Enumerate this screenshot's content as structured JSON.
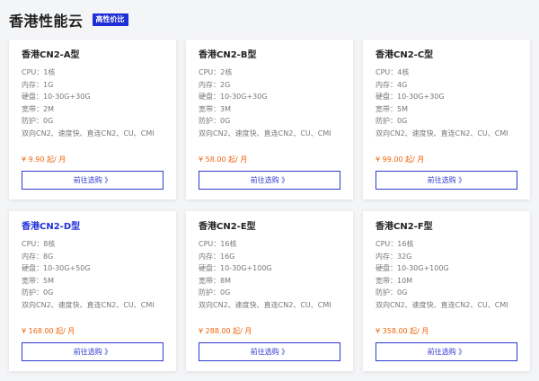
{
  "header": {
    "title": "香港性能云",
    "badge": "高性价比"
  },
  "labels": {
    "cpu": "CPU：",
    "mem": "内存：",
    "disk": "硬盘：",
    "bw": "宽带：",
    "ddos": "防护："
  },
  "cards": [
    {
      "name": "香港CN2-A型",
      "cpu": "1核",
      "mem": "1G",
      "disk": "10-30G+30G",
      "bw": "2M",
      "ddos": "0G",
      "features": "双向CN2、速度快、直连CN2、CU、CMI",
      "price": "¥ 9.90 起/ 月",
      "button": "前往选购 》"
    },
    {
      "name": "香港CN2-B型",
      "cpu": "2核",
      "mem": "2G",
      "disk": "10-30G+30G",
      "bw": "3M",
      "ddos": "0G",
      "features": "双向CN2、速度快、直连CN2、CU、CMI",
      "price": "¥ 58.00 起/ 月",
      "button": "前往选购 》"
    },
    {
      "name": "香港CN2-C型",
      "cpu": "4核",
      "mem": "4G",
      "disk": "10-30G+30G",
      "bw": "5M",
      "ddos": "0G",
      "features": "双向CN2、速度快、直连CN2、CU、CMI",
      "price": "¥ 99.00 起/ 月",
      "button": "前往选购 》"
    },
    {
      "name": "香港CN2-D型",
      "cpu": "8核",
      "mem": "8G",
      "disk": "10-30G+50G",
      "bw": "5M",
      "ddos": "0G",
      "features": "双向CN2、速度快、直连CN2、CU、CMI",
      "price": "¥ 168.00 起/ 月",
      "button": "前往选购 》"
    },
    {
      "name": "香港CN2-E型",
      "cpu": "16核",
      "mem": "16G",
      "disk": "10-30G+100G",
      "bw": "8M",
      "ddos": "0G",
      "features": "双向CN2、速度快、直连CN2、CU、CMI",
      "price": "¥ 288.00 起/ 月",
      "button": "前往选购 》"
    },
    {
      "name": "香港CN2-F型",
      "cpu": "16核",
      "mem": "32G",
      "disk": "10-30G+100G",
      "bw": "10M",
      "ddos": "0G",
      "features": "双向CN2、速度快、直连CN2、CU、CMI",
      "price": "¥ 358.00 起/ 月",
      "button": "前往选购 》"
    }
  ],
  "colors": {
    "accent": "#1f2fd6",
    "price": "#f0650d",
    "background": "#f4f5f7"
  }
}
